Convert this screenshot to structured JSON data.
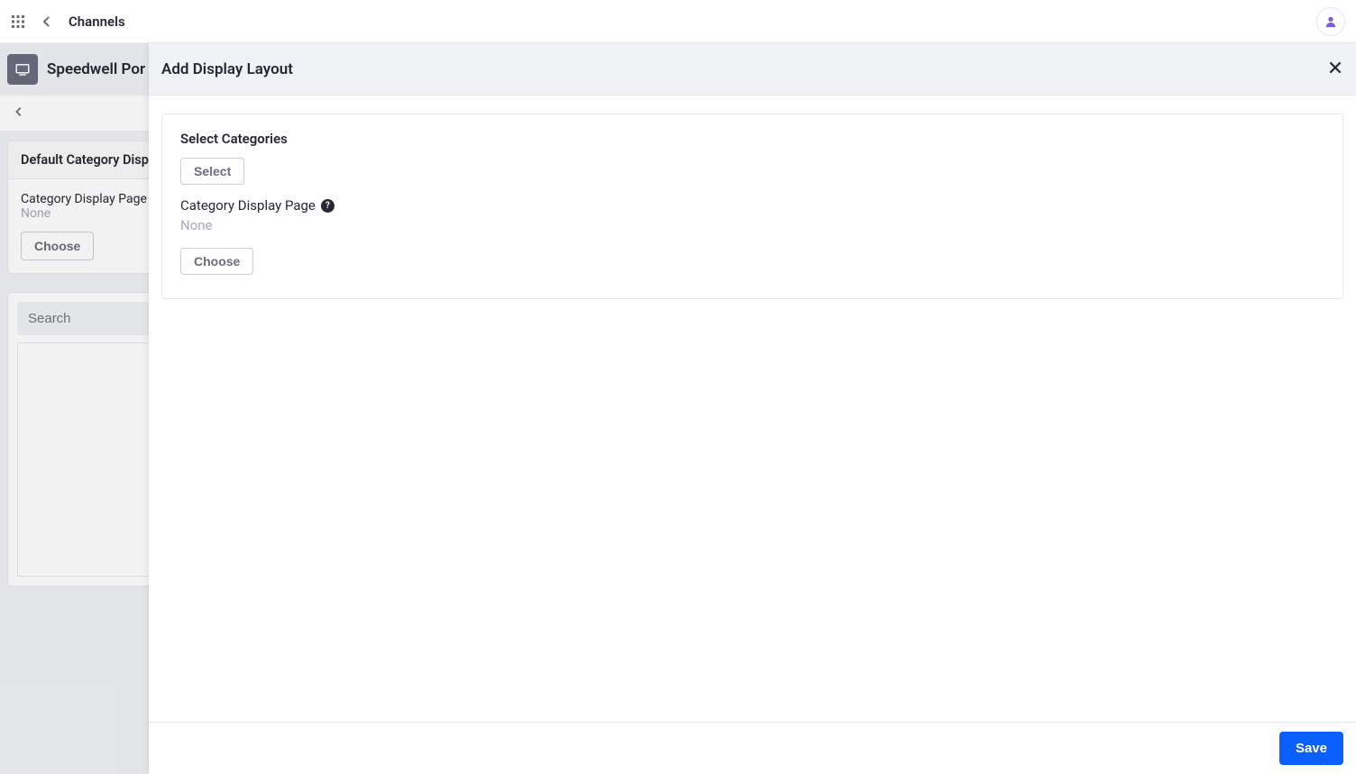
{
  "topbar": {
    "title": "Channels"
  },
  "subbar": {
    "title": "Speedwell Por"
  },
  "sidebar": {
    "default_card": {
      "header": "Default Category Disp",
      "label": "Category Display Page",
      "value": "None",
      "choose_label": "Choose"
    },
    "search_placeholder": "Search"
  },
  "panel": {
    "title": "Add Display Layout",
    "section_label": "Select Categories",
    "select_label": "Select",
    "field_label": "Category Display Page",
    "field_value": "None",
    "choose_label": "Choose",
    "help_symbol": "?",
    "save_label": "Save"
  }
}
